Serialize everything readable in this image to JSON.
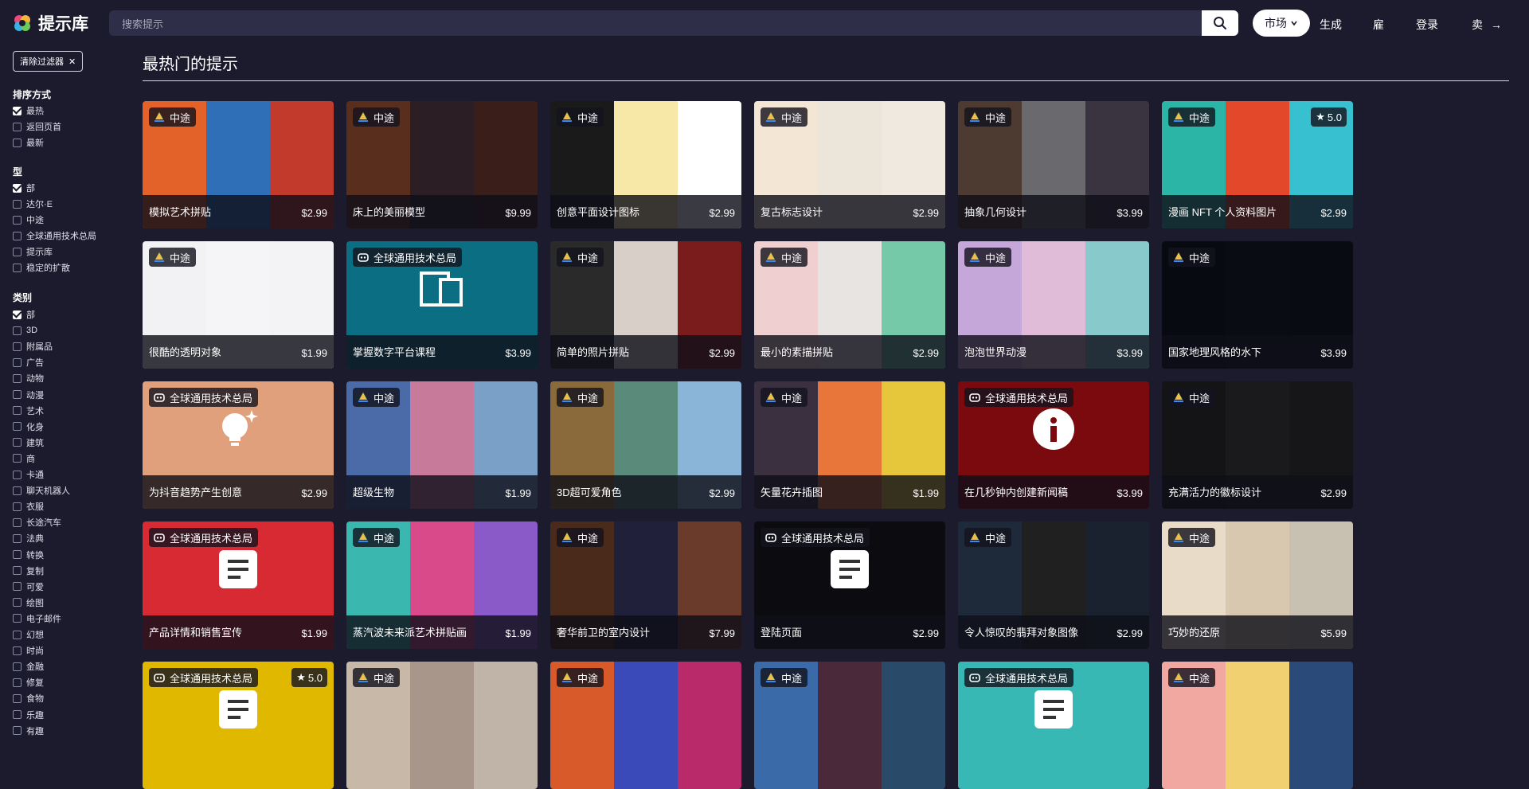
{
  "header": {
    "logo_text": "提示库",
    "search_placeholder": "搜索提示",
    "market_label": "市场",
    "nav": [
      "生成",
      "雇",
      "登录",
      "卖"
    ]
  },
  "sidebar": {
    "clear_filters": "清除过滤器",
    "sort_title": "排序方式",
    "sort_options": [
      {
        "label": "最热",
        "checked": true
      },
      {
        "label": "返回页首",
        "checked": false
      },
      {
        "label": "最新",
        "checked": false
      }
    ],
    "type_title": "型",
    "type_options": [
      {
        "label": "部",
        "checked": true
      },
      {
        "label": "达尔·E",
        "checked": false
      },
      {
        "label": "中途",
        "checked": false
      },
      {
        "label": "全球通用技术总局",
        "checked": false
      },
      {
        "label": "提示库",
        "checked": false
      },
      {
        "label": "稳定的扩散",
        "checked": false
      }
    ],
    "category_title": "类别",
    "category_options": [
      {
        "label": "部",
        "checked": true
      },
      {
        "label": "3D",
        "checked": false
      },
      {
        "label": "附属品",
        "checked": false
      },
      {
        "label": "广告",
        "checked": false
      },
      {
        "label": "动物",
        "checked": false
      },
      {
        "label": "动漫",
        "checked": false
      },
      {
        "label": "艺术",
        "checked": false
      },
      {
        "label": "化身",
        "checked": false
      },
      {
        "label": "建筑",
        "checked": false
      },
      {
        "label": "商",
        "checked": false
      },
      {
        "label": "卡通",
        "checked": false
      },
      {
        "label": "聊天机器人",
        "checked": false
      },
      {
        "label": "衣服",
        "checked": false
      },
      {
        "label": "长途汽车",
        "checked": false
      },
      {
        "label": "法典",
        "checked": false
      },
      {
        "label": "转换",
        "checked": false
      },
      {
        "label": "复制",
        "checked": false
      },
      {
        "label": "可爱",
        "checked": false
      },
      {
        "label": "绘图",
        "checked": false
      },
      {
        "label": "电子邮件",
        "checked": false
      },
      {
        "label": "幻想",
        "checked": false
      },
      {
        "label": "时尚",
        "checked": false
      },
      {
        "label": "金融",
        "checked": false
      },
      {
        "label": "修复",
        "checked": false
      },
      {
        "label": "食物",
        "checked": false
      },
      {
        "label": "乐趣",
        "checked": false
      },
      {
        "label": "有趣",
        "checked": false
      }
    ]
  },
  "main": {
    "title": "最热门的提示",
    "cards": [
      {
        "title": "模拟艺术拼贴",
        "price": "$2.99",
        "badge": "中途",
        "badge_type": "mj",
        "rating": "",
        "colors": [
          "#e2622a",
          "#2f6fb8",
          "#c23a2c"
        ],
        "icon": ""
      },
      {
        "title": "床上的美丽模型",
        "price": "$9.99",
        "badge": "中途",
        "badge_type": "mj",
        "rating": "",
        "colors": [
          "#5a2e1c",
          "#2b1e24",
          "#3a1e1a"
        ],
        "icon": ""
      },
      {
        "title": "创意平面设计图标",
        "price": "$2.99",
        "badge": "中途",
        "badge_type": "mj",
        "rating": "",
        "colors": [
          "#1a1a1a",
          "#f8e8a8",
          "#ffffff"
        ],
        "icon": ""
      },
      {
        "title": "复古标志设计",
        "price": "$2.99",
        "badge": "中途",
        "badge_type": "mj",
        "rating": "",
        "colors": [
          "#f3e6d5",
          "#ece6da",
          "#efe9df"
        ],
        "icon": ""
      },
      {
        "title": "抽象几何设计",
        "price": "$3.99",
        "badge": "中途",
        "badge_type": "mj",
        "rating": "",
        "colors": [
          "#4d3a30",
          "#6a6a6e",
          "#3a3440"
        ],
        "icon": ""
      },
      {
        "title": "漫画 NFT 个人资料图片",
        "price": "$2.99",
        "badge": "中途",
        "badge_type": "mj",
        "rating": "5.0",
        "colors": [
          "#2bb5a7",
          "#e4482a",
          "#37c0cf"
        ],
        "icon": ""
      },
      {
        "title": "很酷的透明对象",
        "price": "$1.99",
        "badge": "中途",
        "badge_type": "mj",
        "rating": "",
        "colors": [
          "#f2f2f4",
          "#f5f5f7",
          "#f3f3f5"
        ],
        "icon": ""
      },
      {
        "title": "掌握数字平台课程",
        "price": "$3.99",
        "badge": "全球通用技术总局",
        "badge_type": "gpt",
        "rating": "",
        "colors": [
          "#0b6e82",
          "#0b6e82",
          "#0b6e82"
        ],
        "icon": "devices"
      },
      {
        "title": "简单的照片拼贴",
        "price": "$2.99",
        "badge": "中途",
        "badge_type": "mj",
        "rating": "",
        "colors": [
          "#2a2a2a",
          "#d8d0c8",
          "#7a1c1c"
        ],
        "icon": ""
      },
      {
        "title": "最小的素描拼贴",
        "price": "$2.99",
        "badge": "中途",
        "badge_type": "mj",
        "rating": "",
        "colors": [
          "#f0cfd0",
          "#e8e4e2",
          "#76c9a8"
        ],
        "icon": ""
      },
      {
        "title": "泡泡世界动漫",
        "price": "$3.99",
        "badge": "中途",
        "badge_type": "mj",
        "rating": "",
        "colors": [
          "#c6a7d9",
          "#e1bcd8",
          "#88c9cc"
        ],
        "icon": ""
      },
      {
        "title": "国家地理风格的水下",
        "price": "$3.99",
        "badge": "中途",
        "badge_type": "mj",
        "rating": "",
        "colors": [
          "#080a12",
          "#0a0c14",
          "#090b13"
        ],
        "icon": ""
      },
      {
        "title": "为抖音趋势产生创意",
        "price": "$2.99",
        "badge": "全球通用技术总局",
        "badge_type": "gpt",
        "rating": "",
        "colors": [
          "#e0a07c",
          "#e0a07c",
          "#e0a07c"
        ],
        "icon": "bulb"
      },
      {
        "title": "超级生物",
        "price": "$1.99",
        "badge": "中途",
        "badge_type": "mj",
        "rating": "",
        "colors": [
          "#4a6aa8",
          "#c87a9a",
          "#7aa0c8"
        ],
        "icon": ""
      },
      {
        "title": "3D超可爱角色",
        "price": "$2.99",
        "badge": "中途",
        "badge_type": "mj",
        "rating": "",
        "colors": [
          "#8a6a3a",
          "#5a8a7a",
          "#8ab4d8"
        ],
        "icon": ""
      },
      {
        "title": "矢量花卉插图",
        "price": "$1.99",
        "badge": "中途",
        "badge_type": "mj",
        "rating": "",
        "colors": [
          "#3a3040",
          "#e8763a",
          "#e6c63a"
        ],
        "icon": ""
      },
      {
        "title": "在几秒钟内创建新闻稿",
        "price": "$3.99",
        "badge": "全球通用技术总局",
        "badge_type": "gpt",
        "rating": "",
        "colors": [
          "#7a0a0e",
          "#7a0a0e",
          "#7a0a0e"
        ],
        "icon": "info"
      },
      {
        "title": "充满活力的徽标设计",
        "price": "$2.99",
        "badge": "中途",
        "badge_type": "mj",
        "rating": "",
        "colors": [
          "#141416",
          "#1a1a1c",
          "#161618"
        ],
        "icon": ""
      },
      {
        "title": "产品详情和销售宣传",
        "price": "$1.99",
        "badge": "全球通用技术总局",
        "badge_type": "gpt",
        "rating": "",
        "colors": [
          "#d72a32",
          "#d72a32",
          "#d72a32"
        ],
        "icon": "doc"
      },
      {
        "title": "蒸汽波未来派艺术拼贴画",
        "price": "$1.99",
        "badge": "中途",
        "badge_type": "mj",
        "rating": "",
        "colors": [
          "#3ab8b0",
          "#d84a8a",
          "#8a5ac8"
        ],
        "icon": ""
      },
      {
        "title": "奢华前卫的室内设计",
        "price": "$7.99",
        "badge": "中途",
        "badge_type": "mj",
        "rating": "",
        "colors": [
          "#4a2a1a",
          "#20203a",
          "#6a3a2a"
        ],
        "icon": ""
      },
      {
        "title": "登陆页面",
        "price": "$2.99",
        "badge": "全球通用技术总局",
        "badge_type": "gpt",
        "rating": "",
        "colors": [
          "#0c0c10",
          "#0c0c10",
          "#0c0c10"
        ],
        "icon": "doc"
      },
      {
        "title": "令人惊叹的翡拜对象图像",
        "price": "$2.99",
        "badge": "中途",
        "badge_type": "mj",
        "rating": "",
        "colors": [
          "#1e2a3a",
          "#202020",
          "#1a2230"
        ],
        "icon": ""
      },
      {
        "title": "巧妙的还原",
        "price": "$5.99",
        "badge": "中途",
        "badge_type": "mj",
        "rating": "",
        "colors": [
          "#e8dcc8",
          "#d8c8b0",
          "#c8c0b0"
        ],
        "icon": ""
      },
      {
        "title": "",
        "price": "",
        "badge": "全球通用技术总局",
        "badge_type": "gpt",
        "rating": "5.0",
        "colors": [
          "#e0b800",
          "#e0b800",
          "#e0b800"
        ],
        "icon": "doc"
      },
      {
        "title": "",
        "price": "",
        "badge": "中途",
        "badge_type": "mj",
        "rating": "",
        "colors": [
          "#c8b8a8",
          "#a8968a",
          "#c0b4a8"
        ],
        "icon": ""
      },
      {
        "title": "",
        "price": "",
        "badge": "中途",
        "badge_type": "mj",
        "rating": "",
        "colors": [
          "#d85a2a",
          "#3a4ab8",
          "#b82a6a"
        ],
        "icon": ""
      },
      {
        "title": "",
        "price": "",
        "badge": "中途",
        "badge_type": "mj",
        "rating": "",
        "colors": [
          "#3a6aa8",
          "#4a2a3a",
          "#2a4a6a"
        ],
        "icon": ""
      },
      {
        "title": "",
        "price": "",
        "badge": "全球通用技术总局",
        "badge_type": "gpt",
        "rating": "",
        "colors": [
          "#38b8b4",
          "#38b8b4",
          "#38b8b4"
        ],
        "icon": "doc"
      },
      {
        "title": "",
        "price": "",
        "badge": "中途",
        "badge_type": "mj",
        "rating": "",
        "colors": [
          "#f0a8a0",
          "#f0d070",
          "#2a4a7a"
        ],
        "icon": ""
      }
    ]
  }
}
